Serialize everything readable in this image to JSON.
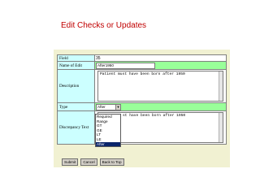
{
  "slide_title": "Edit Checks or Updates",
  "form": {
    "field_label": "Field",
    "field_value": "35",
    "name_label": "Name of Edit",
    "name_value": "After1950",
    "description_label": "Description",
    "description_value": "Patient must have been born after 1950",
    "type_label": "Type",
    "type_selected": "After",
    "type_options": [
      "Required",
      "Range",
      "GT",
      "GE",
      "LT",
      "LE",
      "After"
    ],
    "discrepancy_label": "Discrepancy Text",
    "discrepancy_value_visible": "st have been born after 1950"
  },
  "buttons": {
    "submit": "Submit",
    "cancel": "Cancel",
    "back": "Back to Top"
  },
  "colors": {
    "title": "#c00000",
    "label_bg": "#ccffff",
    "row_green": "#99ff99",
    "frame_bg": "#f1f1d2",
    "selected_option": "#0a246a"
  }
}
